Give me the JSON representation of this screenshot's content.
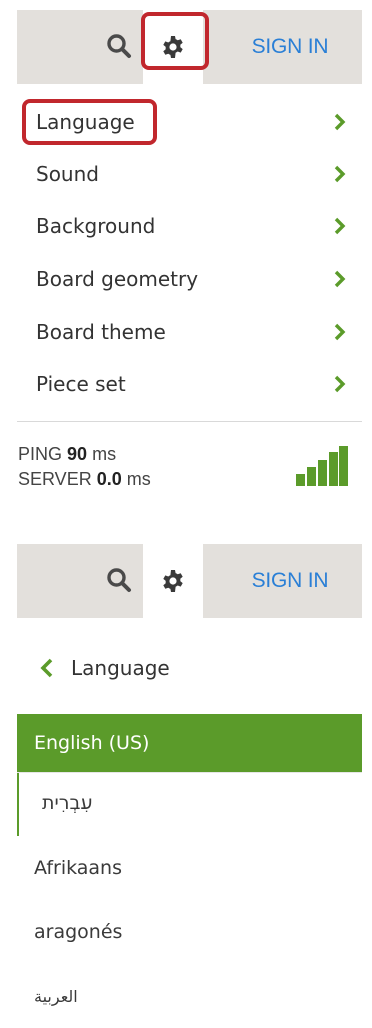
{
  "panel1": {
    "header": {
      "signin_label": "SIGN IN"
    },
    "menu": [
      {
        "label": "Language"
      },
      {
        "label": "Sound"
      },
      {
        "label": "Background"
      },
      {
        "label": "Board geometry"
      },
      {
        "label": "Board theme"
      },
      {
        "label": "Piece set"
      }
    ],
    "status": {
      "ping_label": "PING",
      "ping_value": "90",
      "ping_unit": "ms",
      "server_label": "SERVER",
      "server_value": "0.0",
      "server_unit": "ms"
    },
    "signal_level": 4
  },
  "panel2": {
    "header": {
      "signin_label": "SIGN IN"
    },
    "back_label": "Language",
    "languages": [
      {
        "label": "English (US)",
        "selected": true
      },
      {
        "label": "עִבְרִית",
        "selected": false
      },
      {
        "label": "Afrikaans",
        "selected": false
      },
      {
        "label": "aragonés",
        "selected": false
      },
      {
        "label": "العربية",
        "selected": false
      }
    ]
  },
  "colors": {
    "accent_green": "#5b9b2a",
    "signin_blue": "#2a7fd6",
    "highlight_red": "#c1272d",
    "topbar_bg": "#e3e0dc"
  }
}
